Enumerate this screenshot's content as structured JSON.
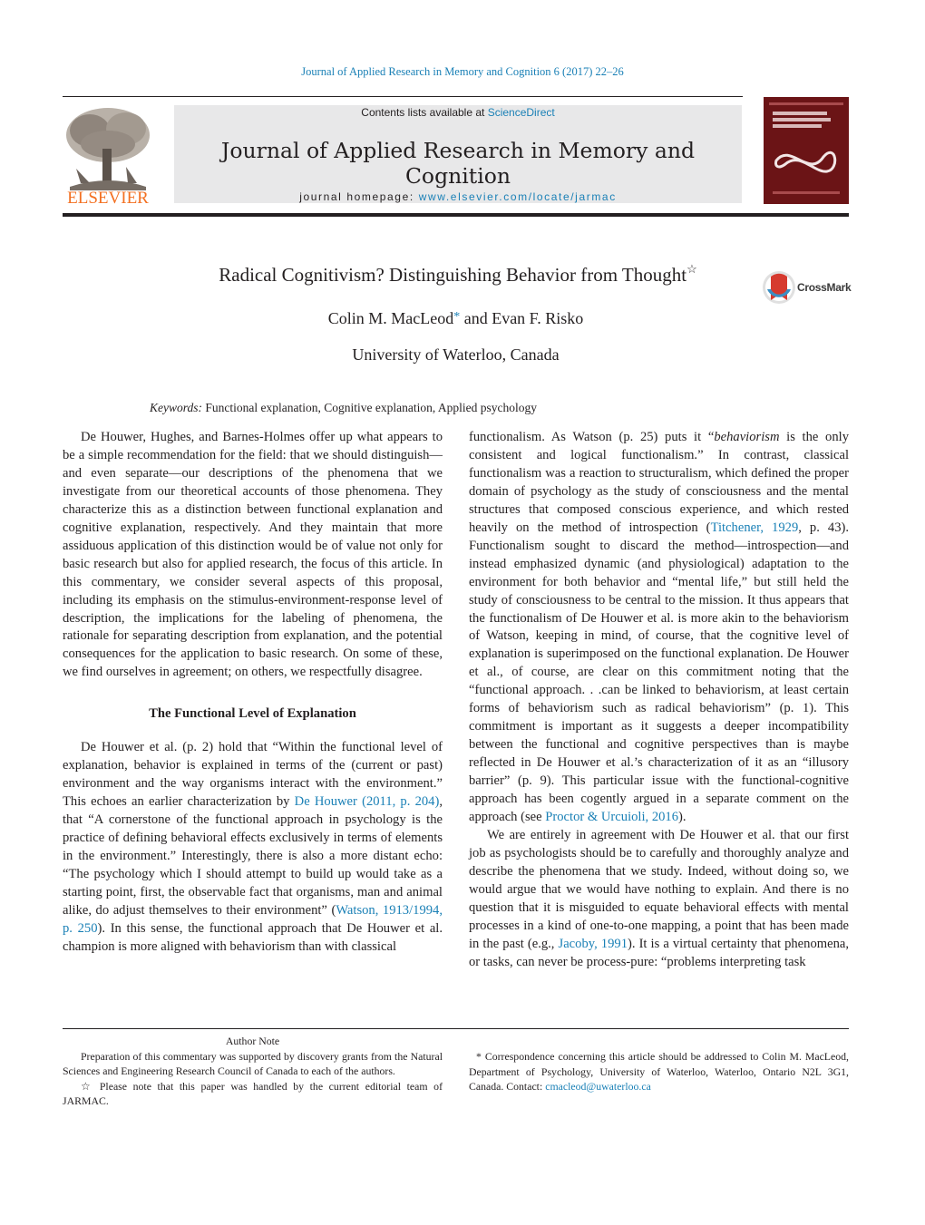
{
  "header": {
    "journal_reference": "Journal of Applied Research in Memory and Cognition 6 (2017) 22–26",
    "contents_prefix": "Contents lists available at ",
    "contents_link": "ScienceDirect",
    "journal_title": "Journal of Applied Research in Memory and Cognition",
    "homepage_prefix": "journal homepage: ",
    "homepage_link": "www.elsevier.com/locate/jarmac",
    "publisher_logo_text": "ELSEVIER",
    "cover_alt": "Journal cover"
  },
  "article": {
    "title": "Radical Cognitivism? Distinguishing Behavior from Thought",
    "title_mark": "☆",
    "crossmark_label": "CrossMark",
    "author1": "Colin M. MacLeod",
    "author1_mark": "*",
    "author_and": " and Evan F. Risko",
    "affiliation": "University of Waterloo, Canada",
    "keywords_label": "Keywords:",
    "keywords": " Functional explanation, Cognitive explanation, Applied psychology"
  },
  "body": {
    "left": {
      "p1": "De Houwer, Hughes, and Barnes-Holmes offer up what appears to be a simple recommendation for the field: that we should distinguish—and even separate—our descriptions of the phenomena that we investigate from our theoretical accounts of those phenomena. They characterize this as a distinc­tion between functional explanation and cognitive explanation, respectively. And they maintain that more assiduous applica­tion of this distinction would be of value not only for basic research but also for applied research, the focus of this arti­cle. In this commentary, we consider several aspects of this proposal, including its emphasis on the stimulus-environment-response level of description, the implications for the labeling of phenomena, the rationale for separating description from expla­nation, and the potential consequences for the application to basic research. On some of these, we find ourselves in agree­ment; on others, we respectfully disagree.",
      "heading": "The Functional Level of Explanation",
      "p2_a": "De Houwer et al. (p. 2) hold that “Within the functional level of explanation, behavior is explained in terms of the (current or past) environment and the way organisms interact with the envi­ronment.” This echoes an earlier characterization by ",
      "p2_link1": "De Houwer (2011, p. 204)",
      "p2_b": ", that “A cornerstone of the functional approach in psychology is the practice of defining behavioral effects exclusively in terms of elements in the environment.” Interest­ingly, there is also a more distant echo: “The psychology which I should attempt to build up would take as a starting point, first, the observable fact that organisms, man and animal alike, do adjust themselves to their environment” (",
      "p2_link2": "Watson, 1913/1994, p. 250",
      "p2_c": "). In this sense, the functional approach that De Houwer et al. champion is more aligned with behaviorism than with classical"
    },
    "right": {
      "p1_a": "functionalism. As Watson (p. 25) puts it “",
      "p1_italic": "behaviorism",
      "p1_b": " is the only consistent and logical functionalism.” In contrast, classical functionalism was a reaction to structuralism, which defined the proper domain of psychology as the study of consciousness and the mental structures that composed conscious experience, and which rested heavily on the method of introspection (",
      "p1_link1": "Titchener, 1929",
      "p1_c": ", p. 43). Functionalism sought to discard the method—introspection—and instead emphasized dynamic (and physiological) adaptation to the environment for both behavior and “mental life,” but still held the study of consciousness to be central to the mission. It thus appears that the functionalism of De Houwer et al. is more akin to the behaviorism of Watson, keeping in mind, of course, that the cognitive level of explana­tion is superimposed on the functional explanation. De Houwer et al., of course, are clear on this commitment noting that the “functional approach. . .can be linked to behaviorism, at least certain forms of behaviorism such as radical behaviorism” (p. 1). This commitment is important as it suggests a deeper incompat­ibility between the functional and cognitive perspectives than is maybe reflected in De Houwer et al.’s characterization of it as an “illusory barrier” (p. 9). This particular issue with the functional-cognitive approach has been cogently argued in a separate comment on the approach (see ",
      "p1_link2": "Proctor & Urcuioli, 2016",
      "p1_d": ").",
      "p2_a": "We are entirely in agreement with De Houwer et al. that our first job as psychologists should be to carefully and thoroughly analyze and describe the phenomena that we study. Indeed, without doing so, we would argue that we would have nothing to explain. And there is no question that it is misguided to equate behavioral effects with mental processes in a kind of one-to-one mapping, a point that has been made in the past (e.g., ",
      "p2_link1": "Jacoby, 1991",
      "p2_b": "). It is a virtual certainty that phenomena, or tasks, can never be process-pure: “problems interpreting task"
    }
  },
  "footnotes": {
    "author_note_title": "Author Note",
    "author_note": "Preparation of this commentary was supported by discovery grants from the Natural Sciences and Engineering Research Council of Canada to each of the authors.",
    "star_mark": "☆",
    "editorial_note": " Please note that this paper was handled by the current editorial team of JARMAC.",
    "corr_mark": "*",
    "correspondence": " Correspondence concerning this article should be addressed to Colin M. MacLeod, Department of Psychology, University of Waterloo, Waterloo, Ontario N2L 3G1, Canada. Contact: ",
    "email": "cmacleod@uwaterloo.ca"
  },
  "colors": {
    "link": "#1a80b6",
    "elsevier_orange": "#f37021",
    "header_band": "#e8e8e9",
    "cover": "#6b1416"
  }
}
